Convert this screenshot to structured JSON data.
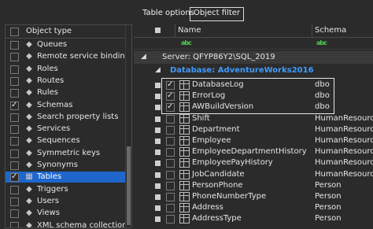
{
  "tabs": {
    "table_options": "Table options",
    "object_filter": "Object filter"
  },
  "left": {
    "header": "Object type",
    "items": [
      {
        "label": "Queues",
        "icon": "queue-icon",
        "checked": false
      },
      {
        "label": "Remote service bindings",
        "icon": "binding-icon",
        "checked": false
      },
      {
        "label": "Roles",
        "icon": "roles-icon",
        "checked": false
      },
      {
        "label": "Routes",
        "icon": "routes-icon",
        "checked": false
      },
      {
        "label": "Rules",
        "icon": "rules-icon",
        "checked": false
      },
      {
        "label": "Schemas",
        "icon": "schemas-icon",
        "checked": true
      },
      {
        "label": "Search property lists",
        "icon": "search-list-icon",
        "checked": false
      },
      {
        "label": "Services",
        "icon": "services-icon",
        "checked": false
      },
      {
        "label": "Sequences",
        "icon": "sequences-icon",
        "checked": false
      },
      {
        "label": "Symmetric keys",
        "icon": "key-icon",
        "checked": false
      },
      {
        "label": "Synonyms",
        "icon": "synonyms-icon",
        "checked": false
      },
      {
        "label": "Tables",
        "icon": "table-icon",
        "checked": true,
        "selected": true
      },
      {
        "label": "Triggers",
        "icon": "triggers-icon",
        "checked": false
      },
      {
        "label": "Users",
        "icon": "users-icon",
        "checked": false
      },
      {
        "label": "Views",
        "icon": "views-icon",
        "checked": false
      },
      {
        "label": "XML schema collections",
        "icon": "xml-icon",
        "checked": false
      }
    ]
  },
  "right": {
    "col_name": "Name",
    "col_schema": "Schema",
    "filter_icon": "abc",
    "server": "Server: QFYP86Y2\\SQL_2019",
    "database": "Database: AdventureWorks2016",
    "rows": [
      {
        "name": "DatabaseLog",
        "schema": "dbo",
        "checked": true
      },
      {
        "name": "ErrorLog",
        "schema": "dbo",
        "checked": true
      },
      {
        "name": "AWBuildVersion",
        "schema": "dbo",
        "checked": true
      },
      {
        "name": "Shift",
        "schema": "HumanResources",
        "checked": false
      },
      {
        "name": "Department",
        "schema": "HumanResources",
        "checked": false
      },
      {
        "name": "Employee",
        "schema": "HumanResources",
        "checked": false
      },
      {
        "name": "EmployeeDepartmentHistory",
        "schema": "HumanResources",
        "checked": false
      },
      {
        "name": "EmployeePayHistory",
        "schema": "HumanResources",
        "checked": false
      },
      {
        "name": "JobCandidate",
        "schema": "HumanResources",
        "checked": false
      },
      {
        "name": "PersonPhone",
        "schema": "Person",
        "checked": false
      },
      {
        "name": "PhoneNumberType",
        "schema": "Person",
        "checked": false
      },
      {
        "name": "Address",
        "schema": "Person",
        "checked": false
      },
      {
        "name": "AddressType",
        "schema": "Person",
        "checked": false
      }
    ]
  }
}
